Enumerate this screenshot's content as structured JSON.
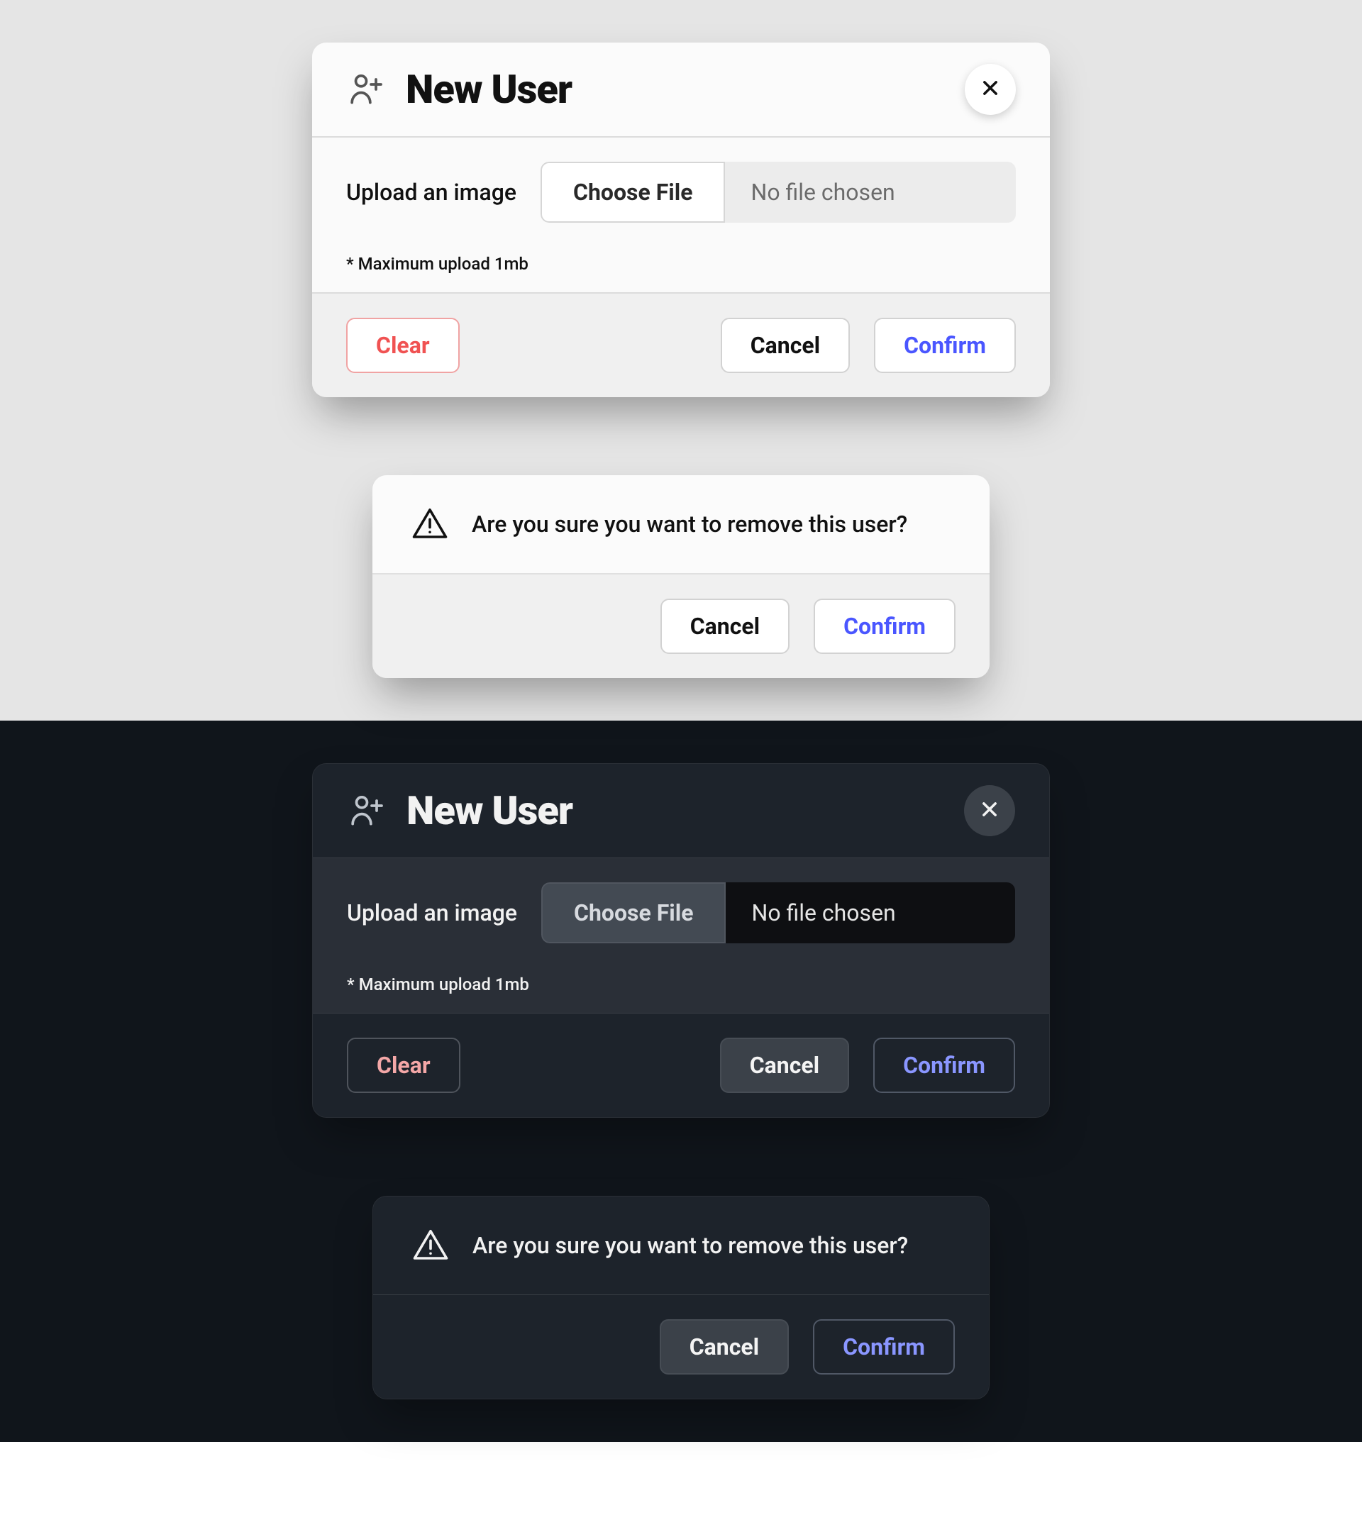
{
  "new_user": {
    "title": "New User",
    "upload_label": "Upload an image",
    "choose_file_label": "Choose File",
    "no_file_text": "No file chosen",
    "hint": "* Maximum upload 1mb",
    "clear_label": "Clear",
    "cancel_label": "Cancel",
    "confirm_label": "Confirm"
  },
  "remove_confirm": {
    "message": "Are you sure you want to remove this user?",
    "cancel_label": "Cancel",
    "confirm_label": "Confirm"
  },
  "colors": {
    "light_bg": "#e5e5e5",
    "dark_bg": "#10151b",
    "primary_light": "#4a56ff",
    "primary_dark": "#8a96ff",
    "danger_light": "#f05252",
    "danger_dark": "#f4a7a7"
  }
}
